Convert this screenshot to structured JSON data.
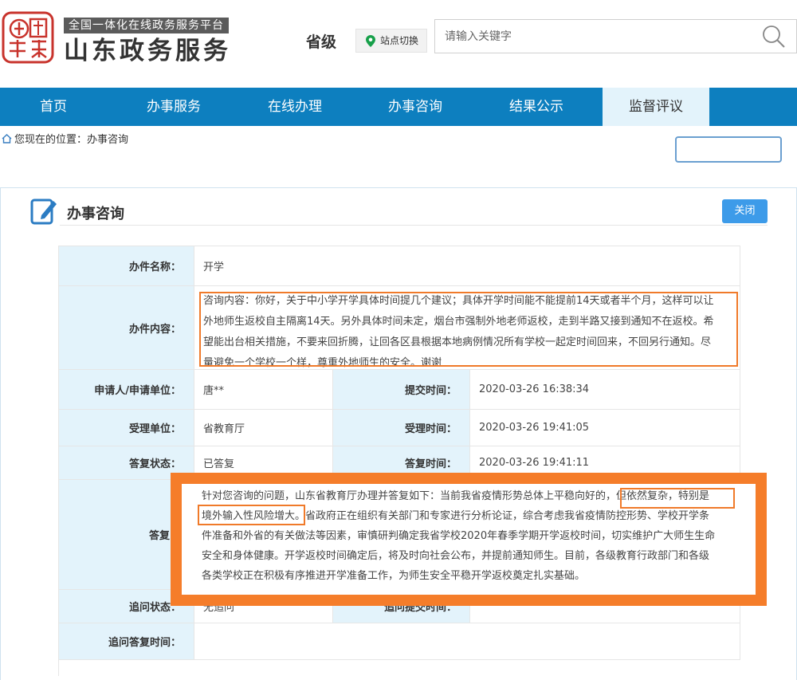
{
  "header": {
    "platform_tag": "全国一体化在线政务服务平台",
    "site_name": "山东政务服务",
    "logo_text": "中國山東",
    "level": "省级",
    "site_switch": "站点切换",
    "search_placeholder": "请输入关键字"
  },
  "nav": {
    "items": [
      {
        "label": "首页"
      },
      {
        "label": "办事服务"
      },
      {
        "label": "在线办理"
      },
      {
        "label": "办事咨询"
      },
      {
        "label": "结果公示"
      },
      {
        "label": "监督评议"
      }
    ],
    "active_index": 5
  },
  "breadcrumb": {
    "text": "您现在的位置：办事咨询"
  },
  "panel": {
    "title": "办事咨询",
    "close_label": "关闭"
  },
  "detail": {
    "item_name_label": "办件名称：",
    "item_name": "开学",
    "content_label": "办件内容：",
    "content_lines": [
      "咨询内容：你好，关于中小学开学具体时间提几个建议；具体开学时间能不能提前14天或者半个月，这样可以让",
      "外地师生返校自主隔离14天。另外具体时间未定，烟台市强制外地老师返校，走到半路又接到通知不在返校。希",
      "望能出台相关措施，不要来回折腾，让回各区县根据本地病例情况所有学校一起定时间回来，不回另行通知。尽",
      "量避免一个学校一个样，尊重外地师生的安全。谢谢"
    ],
    "applicant_label": "申请人/申请单位：",
    "applicant": "唐**",
    "submit_time_label": "提交时间：",
    "submit_time": "2020-03-26 16:38:34",
    "accept_unit_label": "受理单位：",
    "accept_unit": "省教育厅",
    "accept_time_label": "受理时间：",
    "accept_time": "2020-03-26 19:41:05",
    "reply_status_label": "答复状态：",
    "reply_status": "已答复",
    "reply_time_label": "答复时间：",
    "reply_time": "2020-03-26 19:41:11",
    "reply_content_label": "答复内容",
    "reply_lines": [
      "针对您咨询的问题，山东省教育厅办理并答复如下：当前我省疫情形势总体上平稳向好的，但依然复杂，特别是",
      "境外输入性风险增大。省政府正在组织有关部门和专家进行分析论证，综合考虑我省疫情防控形势、学校开学条",
      "件准备和外省的有关做法等因素，审慎研判确定我省学校2020年春季学期开学返校时间，切实维护广大师生生命",
      "安全和身体健康。开学返校时间确定后，将及时向社会公布，并提前通知师生。目前，各级教育行政部门和各级",
      "各类学校正在积极有序推进开学准备工作，为师生安全平稳开学返校奠定扎实基础。"
    ],
    "followup_status_label": "追问状态：",
    "followup_status": "无追问",
    "followup_time_label": "追问提交时间：",
    "followup_reply_label": "追问答复时间："
  },
  "colors": {
    "nav_bg": "#0d7fbf",
    "nav_active_bg": "#e3f3fb",
    "label_bg": "#e3f3fb",
    "highlight": "#f57d2a",
    "button_blue": "#3d9be9",
    "seal_red": "#c8332c"
  }
}
